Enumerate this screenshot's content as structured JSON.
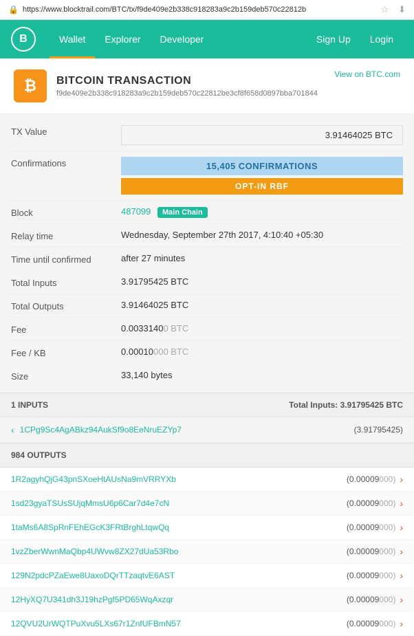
{
  "browser": {
    "url": "https://www.blocktrail.com/BTC/tx/f9de409e2b338c918283a9c2b159deb570c22812b",
    "lock_icon": "🔒"
  },
  "nav": {
    "logo_text": "B",
    "links": [
      {
        "label": "Wallet",
        "active": true
      },
      {
        "label": "Explorer",
        "active": false
      },
      {
        "label": "Developer",
        "active": false
      }
    ],
    "right": [
      {
        "label": "Sign Up"
      },
      {
        "label": "Login"
      }
    ]
  },
  "transaction": {
    "icon": "₿",
    "title": "BITCOIN TRANSACTION",
    "view_link_label": "View on BTC.com",
    "hash": "f9de409e2b338c918283a9c2b159deb570c22812be3cf8f658d0897bba701844",
    "fields": {
      "tx_value_label": "TX Value",
      "tx_value": "3.91464025 BTC",
      "confirmations_label": "Confirmations",
      "confirmations": "15,405 CONFIRMATIONS",
      "rbf": "OPT-IN RBF",
      "block_label": "Block",
      "block_number": "487099",
      "block_badge": "Main Chain",
      "relay_time_label": "Relay time",
      "relay_time": "Wednesday, September 27th 2017, 4:10:40 +05:30",
      "time_confirmed_label": "Time until confirmed",
      "time_confirmed": "after 27 minutes",
      "total_inputs_label": "Total Inputs",
      "total_inputs": "3.91795425 BTC",
      "total_outputs_label": "Total Outputs",
      "total_outputs": "3.91464025 BTC",
      "fee_label": "Fee",
      "fee_main": "0.0033140",
      "fee_dim": "0 BTC",
      "fee_kb_label": "Fee / KB",
      "fee_kb_main": "0.00010",
      "fee_kb_dim": "000 BTC",
      "size_label": "Size",
      "size": "33,140 bytes"
    }
  },
  "inputs": {
    "header_label": "1 INPUTS",
    "total_label": "Total Inputs: 3.91795425 BTC",
    "items": [
      {
        "address": "1CPg9Sc4AgABkz94AukSf9o8EeNruEZYp7",
        "amount": "(3.91795425)"
      }
    ]
  },
  "outputs": {
    "header_label": "984 OUTPUTS",
    "items": [
      {
        "address": "1R2agyhQjG43pnSXoeHtAUsNa9mVRRYXb",
        "amount_main": "(0.00009",
        "amount_dim": "000)"
      },
      {
        "address": "1sd23gyaTSUsSUjqMmsU6p6Car7d4e7cN",
        "amount_main": "(0.00009",
        "amount_dim": "000)"
      },
      {
        "address": "1taMs6A8SpRnFEhEGcK3FRtBrghLtqwQq",
        "amount_main": "(0.00009",
        "amount_dim": "000)"
      },
      {
        "address": "1vzZberWwnMaQbp4UWvw8ZX27dUa53Rbo",
        "amount_main": "(0.00009",
        "amount_dim": "000)"
      },
      {
        "address": "129N2pdcPZaEwe8UaxoDQrTTzaqtvE6AST",
        "amount_main": "(0.00009",
        "amount_dim": "000)"
      },
      {
        "address": "12HyXQ7U341dh3J19hzPgf5PD65WqAxzqr",
        "amount_main": "(0.00009",
        "amount_dim": "000)"
      },
      {
        "address": "12QVU2UrWQTPuXvu5LXs67r1ZnfUFBmN57",
        "amount_main": "(0.00009",
        "amount_dim": "000)"
      }
    ]
  }
}
